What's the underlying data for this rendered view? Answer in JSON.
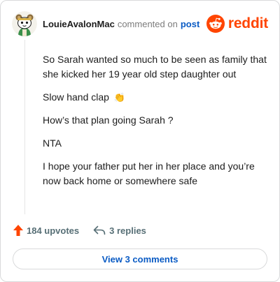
{
  "header": {
    "username": "LouieAvalonMac",
    "verb": "commented on",
    "post_link": "post",
    "logo_text": "reddit",
    "avatar_icon": "snoo-avatar-icon",
    "logo_icon": "reddit-snoo-icon"
  },
  "comment": {
    "paragraphs": [
      "So Sarah wanted so much to be seen as family that she kicked her 19 year old step daughter out",
      "Slow hand clap",
      "How’s that plan going Sarah ?",
      "NTA",
      "I hope your father put her in her place and you’re now back home or somewhere safe"
    ],
    "clap_emoji": "👏"
  },
  "actions": {
    "upvotes_label": "184 upvotes",
    "replies_label": "3 replies",
    "upvote_icon": "upvote-arrow-icon",
    "reply_icon": "reply-arrow-icon"
  },
  "view_comments_label": "View 3 comments",
  "colors": {
    "brand": "#ff4500",
    "link": "#0a5bc4",
    "muted": "#576f76",
    "border": "#d9dadb"
  }
}
